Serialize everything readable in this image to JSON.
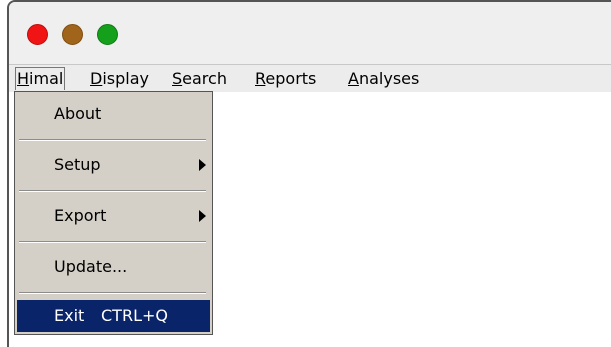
{
  "window": {
    "controls": {
      "close_color": "#f01414",
      "minimize_color": "#a0651a",
      "maximize_color": "#14a01a"
    }
  },
  "menubar": {
    "items": [
      {
        "label": "Himal",
        "active": true
      },
      {
        "label": "Display"
      },
      {
        "label": "Search"
      },
      {
        "label": "Reports"
      },
      {
        "label": "Analyses"
      }
    ]
  },
  "dropdown": {
    "items": [
      {
        "label": "About"
      },
      {
        "label": "Setup",
        "submenu": true
      },
      {
        "label": "Export",
        "submenu": true
      },
      {
        "label": "Update..."
      },
      {
        "label": "Exit",
        "shortcut": "CTRL+Q",
        "selected": true
      }
    ],
    "selected_color": "#0a246a"
  }
}
